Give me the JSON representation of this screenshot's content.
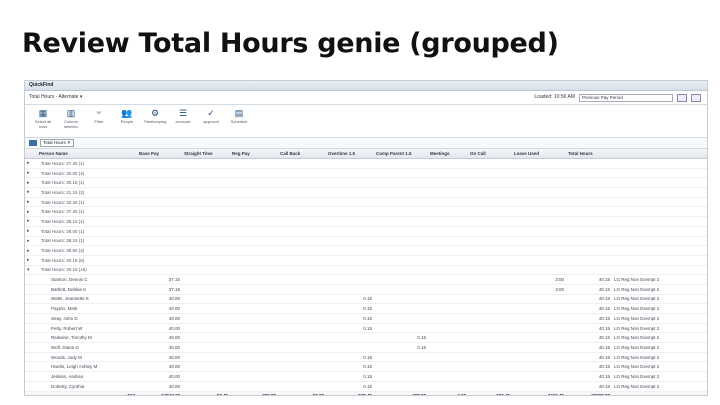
{
  "slide_title": "Review Total Hours genie (grouped)",
  "app": {
    "window_title": "QuickFind",
    "menu_label": "Total Hours - Alternate ▾",
    "loaded_label": "Loaded: 10:56 AM",
    "period_select": "Previous Pay Period",
    "toolbar": [
      {
        "icon": "select-all-icon",
        "glyph": "▦",
        "label": "Select all rows",
        "dim": false
      },
      {
        "icon": "column-selector-icon",
        "glyph": "▥",
        "label": "Column selector",
        "dim": false
      },
      {
        "icon": "filter-icon",
        "glyph": "⏷",
        "label": "Filter",
        "dim": true
      },
      {
        "icon": "people-icon",
        "glyph": "👥",
        "label": "People",
        "dim": false
      },
      {
        "icon": "timekeeping-icon",
        "glyph": "⚙",
        "label": "Timekeeping",
        "dim": false
      },
      {
        "icon": "accruals-icon",
        "glyph": "☰",
        "label": "accruals",
        "dim": false
      },
      {
        "icon": "approve-icon",
        "glyph": "✓",
        "label": "approval",
        "dim": false
      },
      {
        "icon": "schedule-icon",
        "glyph": "▤",
        "label": "Schedule",
        "dim": false
      }
    ],
    "filter_chip": "Total Hours ✕",
    "columns": [
      "",
      "Person Name",
      "Base Pay",
      "Straight Time",
      "Reg Pay",
      "Call Back",
      "Overtime 1.5",
      "Comp Parent 1.5",
      "Meetings",
      "On Call",
      "Leave Used",
      "Total Hours",
      ""
    ],
    "groups": [
      "Total Hours: 27.30 (1)",
      "Total Hours: 30.00 (4)",
      "Total Hours: 30.15 (1)",
      "Total Hours: 31.15 (2)",
      "Total Hours: 32.30 (1)",
      "Total Hours: 37.30 (1)",
      "Total Hours: 38.15 (1)",
      "Total Hours: 38.00 (1)",
      "Total Hours: 39.15 (1)",
      "Total Hours: 39.60 (2)",
      "Total Hours: 40.15 (6)",
      "Total Hours: 40.15 (16)"
    ],
    "rows": [
      {
        "name": "Stanton, Dennis C",
        "base": "37.15",
        "ot": "",
        "comp": "",
        "leave": "3:00",
        "total": "40.15",
        "code": "LG Reg Non Exempt 2"
      },
      {
        "name": "Bartlett, Debbie K",
        "base": "37.15",
        "ot": "",
        "comp": "",
        "leave": "3:00",
        "total": "40.15",
        "code": "LG Reg Non Exempt 2"
      },
      {
        "name": "Watts, Jeannette K",
        "base": "40.00",
        "ot": "0.15",
        "comp": "",
        "leave": "",
        "total": "40.15",
        "code": "LG Reg Non Exempt 2"
      },
      {
        "name": "Payton, Mark",
        "base": "40.00",
        "ot": "0.15",
        "comp": "",
        "leave": "",
        "total": "40.15",
        "code": "LG Reg Non Exempt 2"
      },
      {
        "name": "Seay, John D",
        "base": "40.00",
        "ot": "0.15",
        "comp": "",
        "leave": "",
        "total": "40.15",
        "code": "LG Reg Non Exempt 2"
      },
      {
        "name": "Petty, Robert W",
        "base": "40.00",
        "ot": "0.15",
        "comp": "",
        "leave": "",
        "total": "40.15",
        "code": "LG Reg Non Exempt 2"
      },
      {
        "name": "Redwine, Timothy M",
        "base": "40.00",
        "ot": "",
        "comp": "0.15",
        "leave": "",
        "total": "40.15",
        "code": "LG Reg Non Exempt 2"
      },
      {
        "name": "Wolf, Diana G",
        "base": "40.00",
        "ot": "",
        "comp": "0.15",
        "leave": "",
        "total": "40.15",
        "code": "LG Reg Non Exempt 2"
      },
      {
        "name": "Woods, Judy M",
        "base": "40.00",
        "ot": "0.15",
        "comp": "",
        "leave": "",
        "total": "40.15",
        "code": "LG Reg Non Exempt 2"
      },
      {
        "name": "Hardin, Leigh Ashley M",
        "base": "40.00",
        "ot": "0.15",
        "comp": "",
        "leave": "",
        "total": "40.15",
        "code": "LG Reg Non Exempt 2"
      },
      {
        "name": "Jenkins, Andrea",
        "base": "40.00",
        "ot": "0.15",
        "comp": "",
        "leave": "",
        "total": "40.15",
        "code": "LG Reg Non Exempt 2"
      },
      {
        "name": "Doherty, Cynthia",
        "base": "40.00",
        "ot": "0.15",
        "comp": "",
        "leave": "",
        "total": "40.15",
        "code": "LG Reg Non Exempt 2"
      }
    ],
    "totals": [
      "",
      "913",
      "24847.23",
      "97.45",
      "776.88",
      "97.30",
      "572.45",
      "208.00",
      "4.00",
      "692.45",
      "3463.45",
      "29008.07",
      ""
    ]
  }
}
